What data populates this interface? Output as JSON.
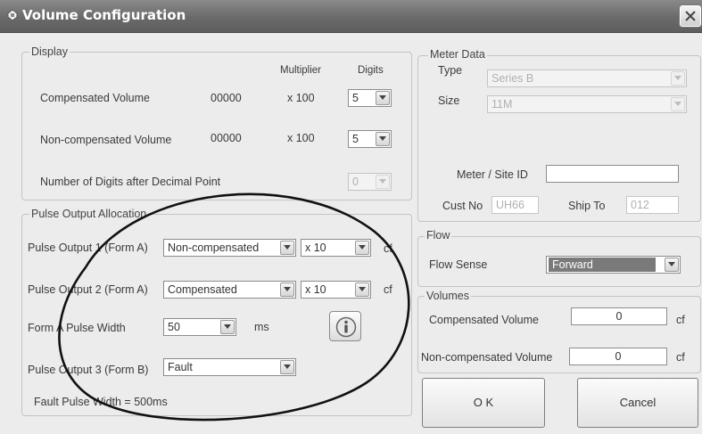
{
  "window": {
    "title": "Volume Configuration"
  },
  "display": {
    "group_label": "Display",
    "multiplier_header": "Multiplier",
    "digits_header": "Digits",
    "rows": [
      {
        "label": "Compensated Volume",
        "value": "00000",
        "multiplier": "x 100",
        "digits": "5"
      },
      {
        "label": "Non-compensated Volume",
        "value": "00000",
        "multiplier": "x 100",
        "digits": "5"
      }
    ],
    "decimal_label": "Number of Digits after Decimal Point",
    "decimal_value": "0"
  },
  "pulse": {
    "group_label": "Pulse Output Allocation",
    "output1_label": "Pulse Output 1 (Form A)",
    "output1_value": "Non-compensated",
    "output1_mult": "x 10",
    "output1_unit": "cf",
    "output2_label": "Pulse Output 2 (Form A)",
    "output2_value": "Compensated",
    "output2_mult": "x 10",
    "output2_unit": "cf",
    "width_label": "Form A Pulse Width",
    "width_value": "50",
    "width_unit": "ms",
    "output3_label": "Pulse Output 3 (Form B)",
    "output3_value": "Fault",
    "fault_text": "Fault Pulse Width = 500ms"
  },
  "meter": {
    "group_label": "Meter Data",
    "type_label": "Type",
    "type_value": "Series B",
    "size_label": "Size",
    "size_value": "11M",
    "site_id_label": "Meter / Site ID",
    "site_id_value": "",
    "cust_no_label": "Cust No",
    "cust_no_value": "UH66",
    "ship_to_label": "Ship To",
    "ship_to_value": "012"
  },
  "flow": {
    "group_label": "Flow",
    "sense_label": "Flow Sense",
    "sense_value": "Forward"
  },
  "volumes": {
    "group_label": "Volumes",
    "compensated_label": "Compensated Volume",
    "compensated_value": "0",
    "compensated_unit": "cf",
    "noncompensated_label": "Non-compensated Volume",
    "noncompensated_value": "0",
    "noncompensated_unit": "cf"
  },
  "buttons": {
    "ok": "O K",
    "cancel": "Cancel"
  },
  "icons": {
    "app": "app-icon",
    "close": "close-icon",
    "info": "info-icon",
    "dropdown": "chevron-down-icon"
  }
}
